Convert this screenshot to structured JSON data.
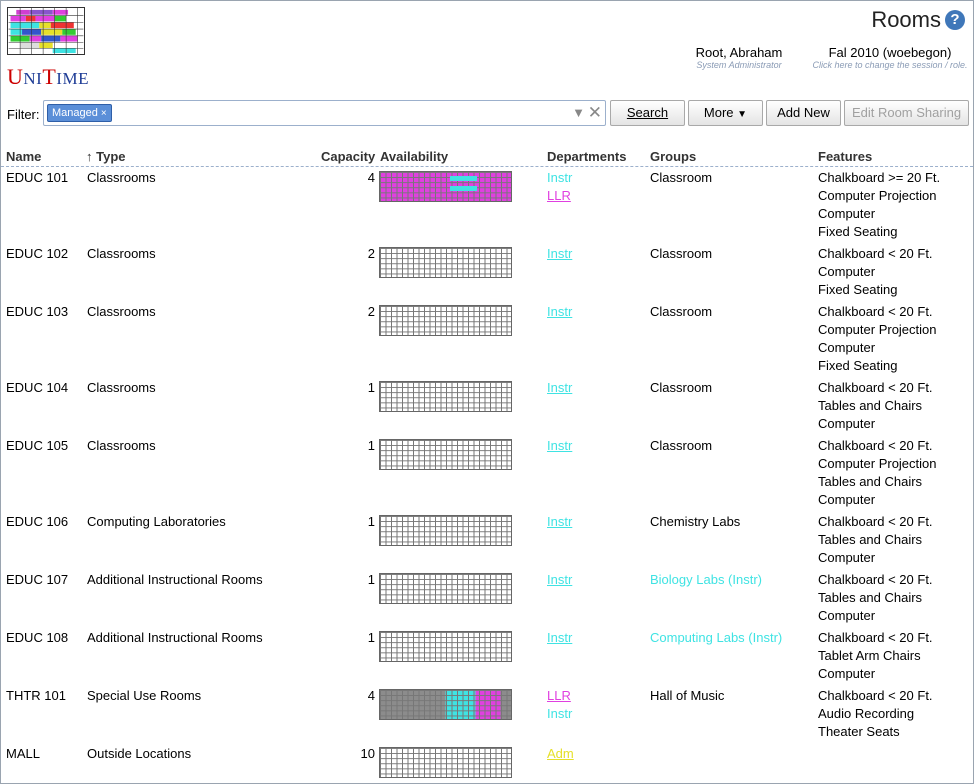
{
  "app": {
    "title": "Rooms",
    "logo_text": "UniTime"
  },
  "user": {
    "name": "Root, Abraham",
    "role": "System Administrator"
  },
  "session": {
    "name": "Fal 2010 (woebegon)",
    "hint": "Click here to change the session / role."
  },
  "filter": {
    "label": "Filter:",
    "chip": "Managed"
  },
  "buttons": {
    "search": "Search",
    "more": "More",
    "add_new": "Add New",
    "edit_sharing": "Edit Room Sharing"
  },
  "columns": {
    "name": "Name",
    "type": "Type",
    "sort_indicator": "↑",
    "capacity": "Capacity",
    "availability": "Availability",
    "departments": "Departments",
    "groups": "Groups",
    "features": "Features"
  },
  "colors": {
    "llr": "#e040e0",
    "instr": "#3fe3e3",
    "adm": "#e6e02a",
    "grey": "#8c8c8c"
  },
  "rooms": [
    {
      "name": "EDUC 101",
      "type": "Classrooms",
      "capacity": "4",
      "departments": [
        {
          "label": "Instr",
          "color": "#3fe3e3",
          "link": false
        },
        {
          "label": "LLR",
          "color": "#e040e0",
          "link": true
        }
      ],
      "groups": [
        {
          "label": "Classroom",
          "color": "#000000"
        }
      ],
      "features": [
        "Chalkboard >= 20 Ft.",
        "Computer Projection",
        "Computer",
        "Fixed Seating"
      ],
      "availability": "llr-full"
    },
    {
      "name": "EDUC 102",
      "type": "Classrooms",
      "capacity": "2",
      "departments": [
        {
          "label": "Instr",
          "color": "#3fe3e3",
          "link": true
        }
      ],
      "groups": [
        {
          "label": "Classroom",
          "color": "#000000"
        }
      ],
      "features": [
        "Chalkboard < 20 Ft.",
        "Computer",
        "Fixed Seating"
      ],
      "availability": "empty"
    },
    {
      "name": "EDUC 103",
      "type": "Classrooms",
      "capacity": "2",
      "departments": [
        {
          "label": "Instr",
          "color": "#3fe3e3",
          "link": true
        }
      ],
      "groups": [
        {
          "label": "Classroom",
          "color": "#000000"
        }
      ],
      "features": [
        "Chalkboard < 20 Ft.",
        "Computer Projection",
        "Computer",
        "Fixed Seating"
      ],
      "availability": "empty"
    },
    {
      "name": "EDUC 104",
      "type": "Classrooms",
      "capacity": "1",
      "departments": [
        {
          "label": "Instr",
          "color": "#3fe3e3",
          "link": true
        }
      ],
      "groups": [
        {
          "label": "Classroom",
          "color": "#000000"
        }
      ],
      "features": [
        "Chalkboard < 20 Ft.",
        "Tables and Chairs",
        "Computer"
      ],
      "availability": "empty"
    },
    {
      "name": "EDUC 105",
      "type": "Classrooms",
      "capacity": "1",
      "departments": [
        {
          "label": "Instr",
          "color": "#3fe3e3",
          "link": true
        }
      ],
      "groups": [
        {
          "label": "Classroom",
          "color": "#000000"
        }
      ],
      "features": [
        "Chalkboard < 20 Ft.",
        "Computer Projection",
        "Tables and Chairs",
        "Computer"
      ],
      "availability": "empty"
    },
    {
      "name": "EDUC 106",
      "type": "Computing Laboratories",
      "capacity": "1",
      "departments": [
        {
          "label": "Instr",
          "color": "#3fe3e3",
          "link": true
        }
      ],
      "groups": [
        {
          "label": "Chemistry Labs",
          "color": "#000000"
        }
      ],
      "features": [
        "Chalkboard < 20 Ft.",
        "Tables and Chairs",
        "Computer"
      ],
      "availability": "empty"
    },
    {
      "name": "EDUC 107",
      "type": "Additional Instructional Rooms",
      "capacity": "1",
      "departments": [
        {
          "label": "Instr",
          "color": "#3fe3e3",
          "link": true
        }
      ],
      "groups": [
        {
          "label": "Biology Labs (Instr)",
          "color": "#3fe3e3"
        }
      ],
      "features": [
        "Chalkboard < 20 Ft.",
        "Tables and Chairs",
        "Computer"
      ],
      "availability": "empty"
    },
    {
      "name": "EDUC 108",
      "type": "Additional Instructional Rooms",
      "capacity": "1",
      "departments": [
        {
          "label": "Instr",
          "color": "#3fe3e3",
          "link": true
        }
      ],
      "groups": [
        {
          "label": "Computing Labs (Instr)",
          "color": "#3fe3e3"
        }
      ],
      "features": [
        "Chalkboard < 20 Ft.",
        "Tablet Arm Chairs",
        "Computer"
      ],
      "availability": "empty"
    },
    {
      "name": "THTR 101",
      "type": "Special Use Rooms",
      "capacity": "4",
      "departments": [
        {
          "label": "LLR",
          "color": "#e040e0",
          "link": true
        },
        {
          "label": "Instr",
          "color": "#3fe3e3",
          "link": false
        }
      ],
      "groups": [
        {
          "label": "Hall of Music",
          "color": "#000000"
        }
      ],
      "features": [
        "Chalkboard < 20 Ft.",
        "Audio Recording",
        "Theater Seats"
      ],
      "availability": "mixed"
    },
    {
      "name": "MALL",
      "type": "Outside Locations",
      "capacity": "10",
      "departments": [
        {
          "label": "Adm",
          "color": "#e6e02a",
          "link": true
        }
      ],
      "groups": [],
      "features": [],
      "availability": "empty"
    }
  ]
}
